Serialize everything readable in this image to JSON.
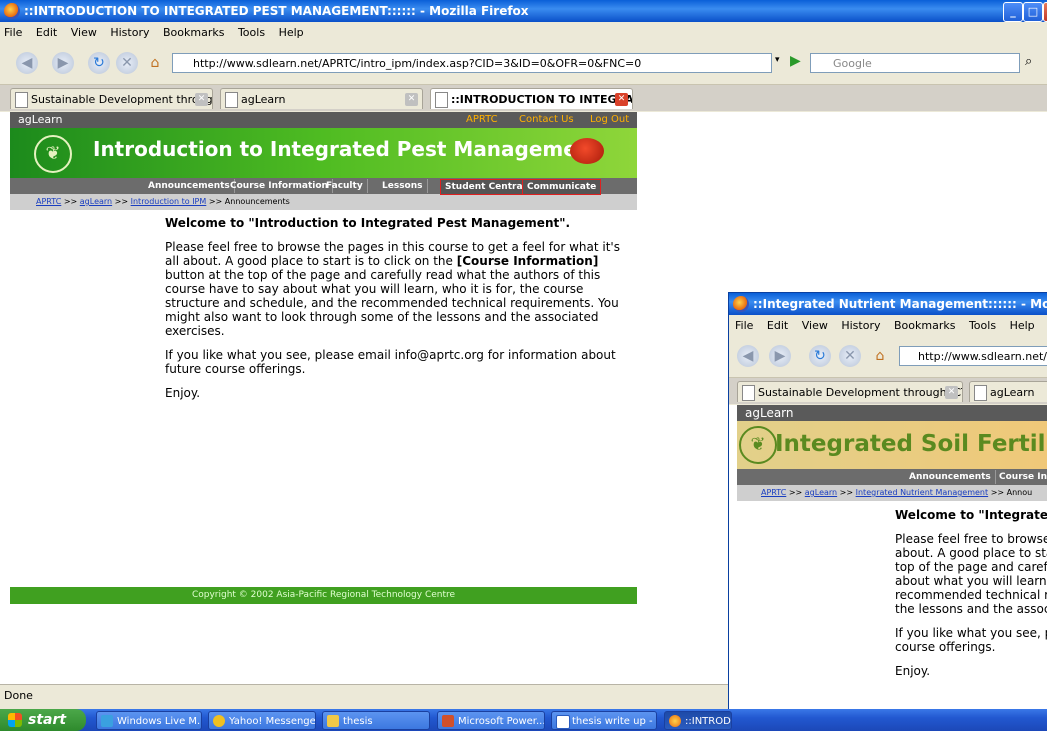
{
  "main_window": {
    "title": "::INTRODUCTION TO INTEGRATED PEST MANAGEMENT:::::: - Mozilla Firefox",
    "menu": [
      "File",
      "Edit",
      "View",
      "History",
      "Bookmarks",
      "Tools",
      "Help"
    ],
    "url": "http://www.sdlearn.net/APRTC/intro_ipm/index.asp?CID=3&ID=0&OFR=0&FNC=0",
    "search_placeholder": "Google",
    "tabs": [
      {
        "label": "Sustainable Development through ICT..."
      },
      {
        "label": "agLearn"
      },
      {
        "label": "::INTRODUCTION TO INTEGRATED ..."
      }
    ],
    "page": {
      "header_brand": "agLearn",
      "header_links": [
        "APRTC",
        "Contact Us",
        "Log Out"
      ],
      "banner_title": "Introduction to Integrated Pest Management",
      "nav_tabs": [
        "Announcements",
        "Course Information",
        "Faculty",
        "Lessons",
        "Student Central",
        "Communicate"
      ],
      "breadcrumb": {
        "links": [
          "APRTC",
          "agLearn",
          "Introduction to IPM"
        ],
        "current": "Announcements",
        "sep": ">>"
      },
      "welcome": "Welcome to \"Introduction to Integrated Pest Management\".",
      "para1_a": "Please feel free to browse the pages in this course to get a feel for what it's all about. A good place to start is to click on the ",
      "para1_bold": "[Course Information]",
      "para1_b": " button at the top of the page and carefully read what the authors of this course have to say about what you will learn, who it is for, the course structure and schedule, and the recommended technical requirements. You might also want to look through some of the lessons and the associated exercises.",
      "para2": "If you like what you see, please email info@aprtc.org for information about future course offerings.",
      "para3": "Enjoy.",
      "copyright": "Copyright © 2002 Asia-Pacific Regional Technology Centre"
    },
    "status": "Done"
  },
  "second_window": {
    "title": "::Integrated Nutrient Management:::::: - Mozilla Firefox",
    "menu": [
      "File",
      "Edit",
      "View",
      "History",
      "Bookmarks",
      "Tools",
      "Help"
    ],
    "url": "http://www.sdlearn.net/APRT",
    "tabs": [
      {
        "label": "Sustainable Development through ICT..."
      },
      {
        "label": "agLearn"
      }
    ],
    "page": {
      "header_brand": "agLearn",
      "banner_title": "Integrated Soil Fertility Mana",
      "nav_tabs": [
        "Announcements",
        "Course Information"
      ],
      "breadcrumb": {
        "links": [
          "APRTC",
          "agLearn",
          "Integrated Nutrient Management"
        ],
        "current": "Annou",
        "sep": ">>"
      },
      "welcome": "Welcome to \"Integrated",
      "para1_lines": [
        "Please feel free to browse",
        "about. A good place to sta",
        "top of the page and carefu",
        "about what you will learn,",
        "recommended technical re",
        "the lessons and the associ"
      ],
      "para2_lines": [
        "If you like what you see, p",
        "course offerings."
      ],
      "para3": "Enjoy."
    }
  },
  "taskbar": {
    "start": "start",
    "items": [
      {
        "label": "Windows Live M...",
        "color": "#3aa0e0"
      },
      {
        "label": "Yahoo! Messenger",
        "color": "#f0c020"
      },
      {
        "label": "thesis",
        "color": "#f0c848"
      },
      {
        "label": "Microsoft Power...",
        "color": "#d0502a"
      },
      {
        "label": "thesis write up - ...",
        "color": "#2a5cc0"
      },
      {
        "label": "::INTRODU",
        "color": "#e86a10"
      }
    ]
  }
}
